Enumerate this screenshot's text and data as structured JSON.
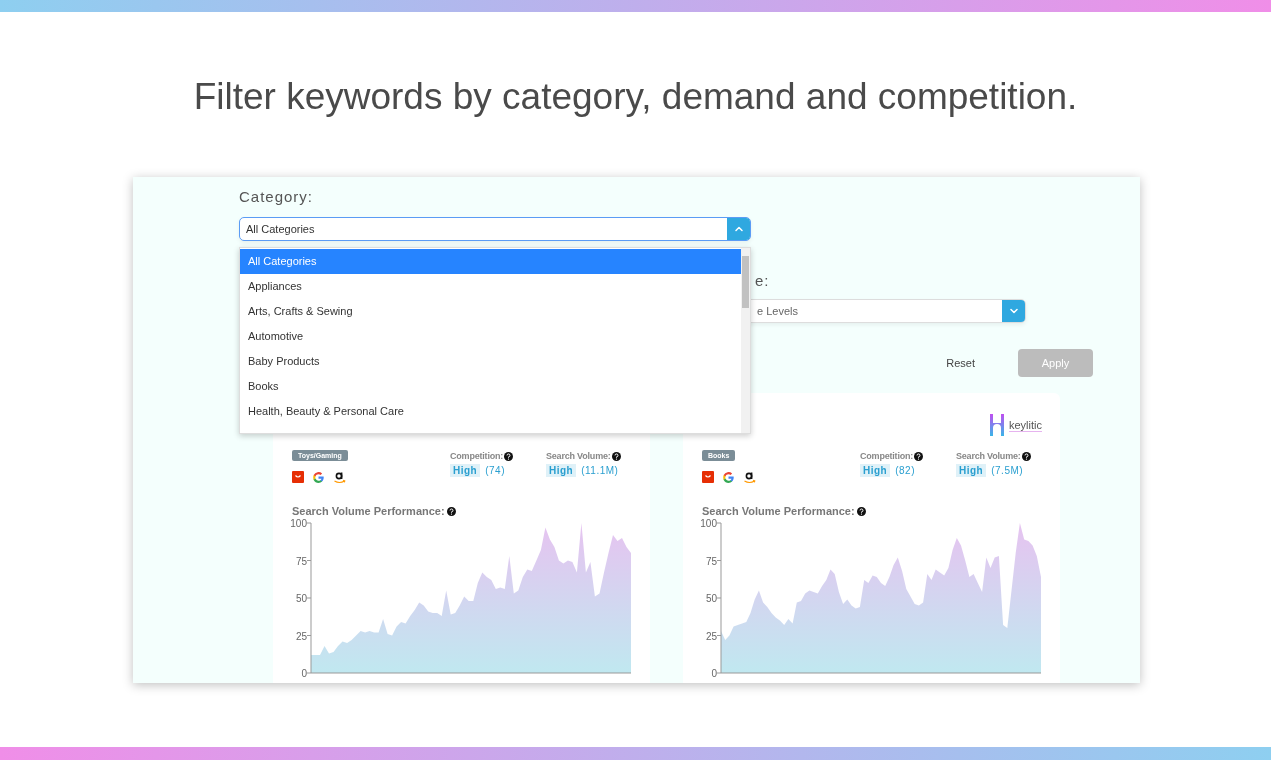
{
  "headline": "Filter keywords by category, demand and competition.",
  "category_filter": {
    "label": "Category:",
    "value": "All Categories",
    "open": true,
    "options": [
      {
        "label": "All Categories",
        "selected": true
      },
      {
        "label": "Appliances",
        "selected": false
      },
      {
        "label": "Arts, Crafts & Sewing",
        "selected": false
      },
      {
        "label": "Automotive",
        "selected": false
      },
      {
        "label": "Baby Products",
        "selected": false
      },
      {
        "label": "Books",
        "selected": false
      },
      {
        "label": "Health, Beauty & Personal Care",
        "selected": false
      }
    ]
  },
  "second_filter": {
    "label": "e:",
    "value": "e Levels",
    "open": false
  },
  "buttons": [
    {
      "label": "Reset",
      "kind": "text",
      "disabled": false
    },
    {
      "label": "Apply",
      "kind": "filled",
      "disabled": true
    }
  ],
  "cards": [
    {
      "tag": "Toys/Gaming",
      "competition": {
        "label": "Competition:",
        "grade": "High",
        "value": "(74)"
      },
      "search_volume": {
        "label": "Search Volume:",
        "grade": "High",
        "value": "(11.1M)"
      },
      "chart_title": "Search Volume Performance:",
      "chart_data": {
        "type": "area",
        "ylim": [
          0,
          100
        ],
        "yticks": [
          0,
          25,
          50,
          75,
          100
        ],
        "series": [
          {
            "color": "#e6c3f0",
            "values": [
              12,
              12,
              12,
              18,
              13,
              14,
              18,
              21,
              20,
              22,
              25,
              28,
              27,
              28,
              27,
              27,
              36,
              26,
              25,
              31,
              34,
              33,
              38,
              42,
              47,
              45,
              41,
              40,
              40,
              38,
              55,
              39,
              40,
              45,
              51,
              48,
              48,
              60,
              67,
              64,
              62,
              56,
              57,
              56,
              78,
              53,
              55,
              64,
              69,
              68,
              75,
              82,
              97,
              89,
              84,
              75,
              73,
              75,
              74,
              67,
              100,
              67,
              74,
              51,
              53,
              67,
              80,
              92,
              88,
              90,
              84,
              80
            ]
          }
        ]
      }
    },
    {
      "tag": "Books",
      "logo": "keylitic",
      "competition": {
        "label": "Competition:",
        "grade": "High",
        "value": "(82)"
      },
      "search_volume": {
        "label": "Search Volume:",
        "grade": "High",
        "value": "(7.5M)"
      },
      "chart_title": "Search Volume Performance:",
      "chart_data": {
        "type": "area",
        "ylim": [
          0,
          100
        ],
        "yticks": [
          0,
          25,
          50,
          75,
          100
        ],
        "series": [
          {
            "color": "#e6c3f0",
            "values": [
              28,
              22,
              25,
              31,
              32,
              33,
              34,
              40,
              49,
              55,
              47,
              44,
              40,
              37,
              35,
              32,
              36,
              33,
              47,
              48,
              53,
              55,
              54,
              53,
              58,
              62,
              69,
              66,
              54,
              46,
              49,
              45,
              43,
              44,
              62,
              60,
              65,
              64,
              60,
              58,
              64,
              72,
              77,
              68,
              56,
              51,
              46,
              45,
              47,
              66,
              62,
              69,
              67,
              65,
              70,
              82,
              90,
              85,
              75,
              64,
              66,
              60,
              54,
              77,
              70,
              77,
              78,
              32,
              30,
              55,
              80,
              100,
              89,
              88,
              85,
              78,
              64
            ]
          }
        ]
      }
    }
  ]
}
